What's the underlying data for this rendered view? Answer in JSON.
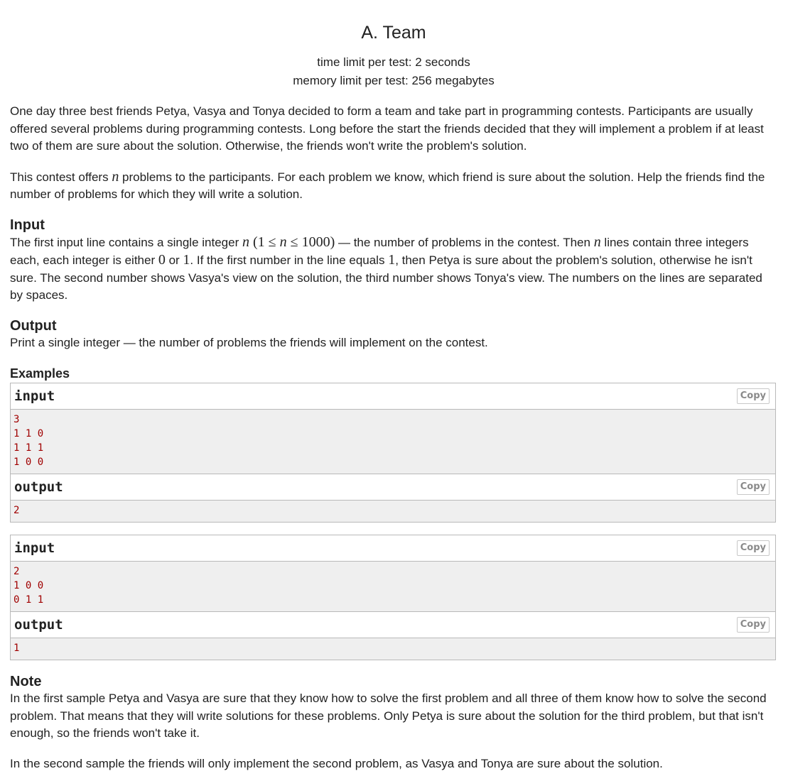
{
  "header": {
    "title": "A. Team",
    "time_limit": "time limit per test: 2 seconds",
    "memory_limit": "memory limit per test: 256 megabytes"
  },
  "legend": {
    "p1": "One day three best friends Petya, Vasya and Tonya decided to form a team and take part in programming contests. Participants are usually offered several problems during programming contests. Long before the start the friends decided that they will implement a problem if at least two of them are sure about the solution. Otherwise, the friends won't write the problem's solution.",
    "p2_a": "This contest offers ",
    "p2_var": "n",
    "p2_b": " problems to the participants. For each problem we know, which friend is sure about the solution. Help the friends find the number of problems for which they will write a solution."
  },
  "input_spec": {
    "title": "Input",
    "t1": "The first input line contains a single integer ",
    "v_n": "n",
    "math_constraint_open": "(1 ≤ ",
    "math_constraint_n": "n",
    "math_constraint_close": " ≤ 1000)",
    "t2": " — the number of problems in the contest. Then ",
    "v_n2": "n",
    "t3": " lines contain three integers each, each integer is either ",
    "m0": "0",
    "t4": " or ",
    "m1": "1",
    "t5": ". If the first number in the line equals ",
    "m1b": "1",
    "t6": ", then Petya is sure about the problem's solution, otherwise he isn't sure. The second number shows Vasya's view on the solution, the third number shows Tonya's view. The numbers on the lines are separated by spaces."
  },
  "output_spec": {
    "title": "Output",
    "text": "Print a single integer — the number of problems the friends will implement on the contest."
  },
  "examples": {
    "title": "Examples",
    "copy_label": "Copy",
    "input_label": "input",
    "output_label": "output",
    "items": [
      {
        "input": [
          "3",
          "1 1 0",
          "1 1 1",
          "1 0 0"
        ],
        "output": [
          "2"
        ]
      },
      {
        "input": [
          "2",
          "1 0 0",
          "0 1 1"
        ],
        "output": [
          "1"
        ]
      }
    ]
  },
  "note": {
    "title": "Note",
    "p1": "In the first sample Petya and Vasya are sure that they know how to solve the first problem and all three of them know how to solve the second problem. That means that they will write solutions for these problems. Only Petya is sure about the solution for the third problem, but that isn't enough, so the friends won't take it.",
    "p2": "In the second sample the friends will only implement the second problem, as Vasya and Tonya are sure about the solution."
  }
}
